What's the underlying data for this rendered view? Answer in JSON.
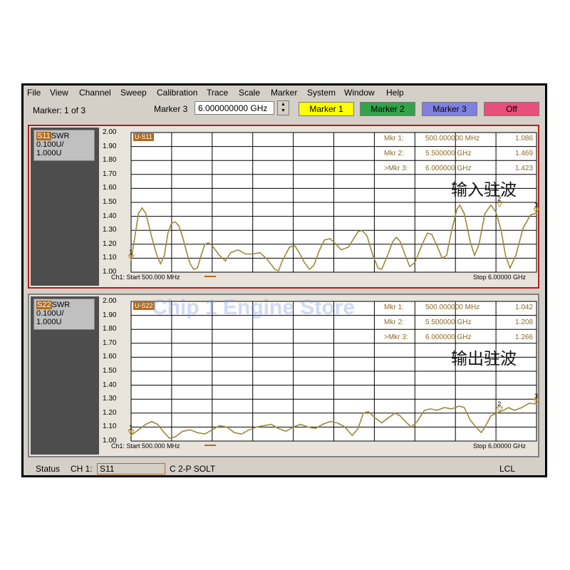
{
  "menu": [
    "File",
    "View",
    "Channel",
    "Sweep",
    "Calibration",
    "Trace",
    "Scale",
    "Marker",
    "System",
    "Window",
    "Help"
  ],
  "toolbar": {
    "marker_count": "Marker: 1 of 3",
    "marker_select": "Marker 3",
    "marker_value": "6.000000000 GHz",
    "buttons": [
      {
        "label": "Marker 1",
        "color": "#ffff00"
      },
      {
        "label": "Marker 2",
        "color": "#33a34a"
      },
      {
        "label": "Marker 3",
        "color": "#8080e0"
      },
      {
        "label": "Off",
        "color": "#e8507a"
      }
    ]
  },
  "panels": [
    {
      "param": "S11",
      "format": "SWR",
      "scale": "0.100U/",
      "ref": "1.000U",
      "trace_badge": "U-S11",
      "y_ticks": [
        "2.00",
        "1.90",
        "1.80",
        "1.70",
        "1.60",
        "1.50",
        "1.40",
        "1.30",
        "1.20",
        "1.10",
        "1.00"
      ],
      "markers": [
        {
          "label": "Mkr 1:",
          "freq": "500.000000 MHz",
          "value": "1.086"
        },
        {
          "label": "Mkr 2:",
          "freq": "5.500000 GHz",
          "value": "1.469"
        },
        {
          "label": ">Mkr 3:",
          "freq": "6.000000 GHz",
          "value": "1.423"
        }
      ],
      "start": "Ch1: Start 500.000 MHz",
      "stop": "Stop 6.00000 GHz",
      "side_label": "输入驻波",
      "trace_color": "#9a8a3a",
      "border_color": "#b02020",
      "trace": [
        [
          0.5,
          1.086
        ],
        [
          0.55,
          1.25
        ],
        [
          0.6,
          1.42
        ],
        [
          0.65,
          1.46
        ],
        [
          0.7,
          1.42
        ],
        [
          0.78,
          1.25
        ],
        [
          0.85,
          1.12
        ],
        [
          0.9,
          1.06
        ],
        [
          0.95,
          1.12
        ],
        [
          1.0,
          1.28
        ],
        [
          1.05,
          1.35
        ],
        [
          1.1,
          1.36
        ],
        [
          1.15,
          1.33
        ],
        [
          1.2,
          1.25
        ],
        [
          1.25,
          1.15
        ],
        [
          1.3,
          1.06
        ],
        [
          1.35,
          1.02
        ],
        [
          1.4,
          1.03
        ],
        [
          1.45,
          1.12
        ],
        [
          1.5,
          1.2
        ],
        [
          1.55,
          1.21
        ],
        [
          1.6,
          1.19
        ],
        [
          1.7,
          1.12
        ],
        [
          1.78,
          1.08
        ],
        [
          1.85,
          1.14
        ],
        [
          1.95,
          1.16
        ],
        [
          2.05,
          1.13
        ],
        [
          2.15,
          1.13
        ],
        [
          2.25,
          1.14
        ],
        [
          2.35,
          1.09
        ],
        [
          2.45,
          1.02
        ],
        [
          2.5,
          1.01
        ],
        [
          2.55,
          1.08
        ],
        [
          2.65,
          1.18
        ],
        [
          2.72,
          1.19
        ],
        [
          2.78,
          1.14
        ],
        [
          2.85,
          1.07
        ],
        [
          2.92,
          1.02
        ],
        [
          2.98,
          1.05
        ],
        [
          3.05,
          1.15
        ],
        [
          3.12,
          1.23
        ],
        [
          3.2,
          1.24
        ],
        [
          3.28,
          1.2
        ],
        [
          3.35,
          1.16
        ],
        [
          3.45,
          1.18
        ],
        [
          3.52,
          1.24
        ],
        [
          3.58,
          1.29
        ],
        [
          3.63,
          1.3
        ],
        [
          3.7,
          1.26
        ],
        [
          3.78,
          1.12
        ],
        [
          3.85,
          1.03
        ],
        [
          3.9,
          1.02
        ],
        [
          3.98,
          1.12
        ],
        [
          4.05,
          1.22
        ],
        [
          4.1,
          1.25
        ],
        [
          4.15,
          1.22
        ],
        [
          4.22,
          1.12
        ],
        [
          4.28,
          1.04
        ],
        [
          4.35,
          1.07
        ],
        [
          4.45,
          1.2
        ],
        [
          4.52,
          1.28
        ],
        [
          4.58,
          1.27
        ],
        [
          4.65,
          1.19
        ],
        [
          4.72,
          1.1
        ],
        [
          4.78,
          1.12
        ],
        [
          4.85,
          1.3
        ],
        [
          4.92,
          1.45
        ],
        [
          4.96,
          1.48
        ],
        [
          5.02,
          1.42
        ],
        [
          5.1,
          1.22
        ],
        [
          5.16,
          1.12
        ],
        [
          5.22,
          1.2
        ],
        [
          5.3,
          1.42
        ],
        [
          5.38,
          1.48
        ],
        [
          5.45,
          1.43
        ],
        [
          5.52,
          1.3
        ],
        [
          5.58,
          1.12
        ],
        [
          5.64,
          1.03
        ],
        [
          5.72,
          1.12
        ],
        [
          5.82,
          1.32
        ],
        [
          5.92,
          1.41
        ],
        [
          6.0,
          1.423
        ]
      ]
    },
    {
      "param": "S22",
      "format": "SWR",
      "scale": "0.100U/",
      "ref": "1.000U",
      "trace_badge": "U-S22",
      "y_ticks": [
        "2.00",
        "1.90",
        "1.80",
        "1.70",
        "1.60",
        "1.50",
        "1.40",
        "1.30",
        "1.20",
        "1.10",
        "1.00"
      ],
      "markers": [
        {
          "label": "Mkr 1:",
          "freq": "500.000000 MHz",
          "value": "1.042"
        },
        {
          "label": "Mkr 2:",
          "freq": "5.500000 GHz",
          "value": "1.208"
        },
        {
          "label": ">Mkr 3:",
          "freq": "6.000000 GHz",
          "value": "1.266"
        }
      ],
      "start": "Ch1: Start 500.000 MHz",
      "stop": "Stop 6.00000 GHz",
      "side_label": "输出驻波",
      "trace_color": "#9a8a3a",
      "border_color": "#808080",
      "trace": [
        [
          0.5,
          1.042
        ],
        [
          0.6,
          1.08
        ],
        [
          0.7,
          1.12
        ],
        [
          0.78,
          1.14
        ],
        [
          0.86,
          1.12
        ],
        [
          0.95,
          1.06
        ],
        [
          1.02,
          1.02
        ],
        [
          1.1,
          1.03
        ],
        [
          1.2,
          1.07
        ],
        [
          1.3,
          1.08
        ],
        [
          1.4,
          1.06
        ],
        [
          1.5,
          1.05
        ],
        [
          1.6,
          1.08
        ],
        [
          1.7,
          1.11
        ],
        [
          1.8,
          1.1
        ],
        [
          1.9,
          1.06
        ],
        [
          2.0,
          1.05
        ],
        [
          2.1,
          1.08
        ],
        [
          2.2,
          1.1
        ],
        [
          2.3,
          1.11
        ],
        [
          2.4,
          1.12
        ],
        [
          2.5,
          1.09
        ],
        [
          2.6,
          1.07
        ],
        [
          2.7,
          1.1
        ],
        [
          2.8,
          1.12
        ],
        [
          2.9,
          1.1
        ],
        [
          3.0,
          1.09
        ],
        [
          3.1,
          1.12
        ],
        [
          3.2,
          1.14
        ],
        [
          3.3,
          1.13
        ],
        [
          3.4,
          1.1
        ],
        [
          3.5,
          1.04
        ],
        [
          3.58,
          1.09
        ],
        [
          3.65,
          1.2
        ],
        [
          3.72,
          1.21
        ],
        [
          3.8,
          1.17
        ],
        [
          3.9,
          1.13
        ],
        [
          4.0,
          1.17
        ],
        [
          4.08,
          1.2
        ],
        [
          4.15,
          1.18
        ],
        [
          4.22,
          1.14
        ],
        [
          4.3,
          1.1
        ],
        [
          4.38,
          1.14
        ],
        [
          4.48,
          1.22
        ],
        [
          4.56,
          1.23
        ],
        [
          4.65,
          1.22
        ],
        [
          4.75,
          1.24
        ],
        [
          4.85,
          1.23
        ],
        [
          4.95,
          1.25
        ],
        [
          5.02,
          1.24
        ],
        [
          5.1,
          1.15
        ],
        [
          5.18,
          1.1
        ],
        [
          5.25,
          1.06
        ],
        [
          5.3,
          1.1
        ],
        [
          5.38,
          1.18
        ],
        [
          5.46,
          1.2
        ],
        [
          5.55,
          1.22
        ],
        [
          5.62,
          1.24
        ],
        [
          5.7,
          1.22
        ],
        [
          5.8,
          1.24
        ],
        [
          5.9,
          1.27
        ],
        [
          6.0,
          1.266
        ]
      ]
    }
  ],
  "watermark": "Chip 1 Engine Store",
  "status": {
    "label": "Status",
    "channel": "CH 1:",
    "field": "S11",
    "cal": "C  2-P SOLT",
    "lcl": "LCL"
  }
}
